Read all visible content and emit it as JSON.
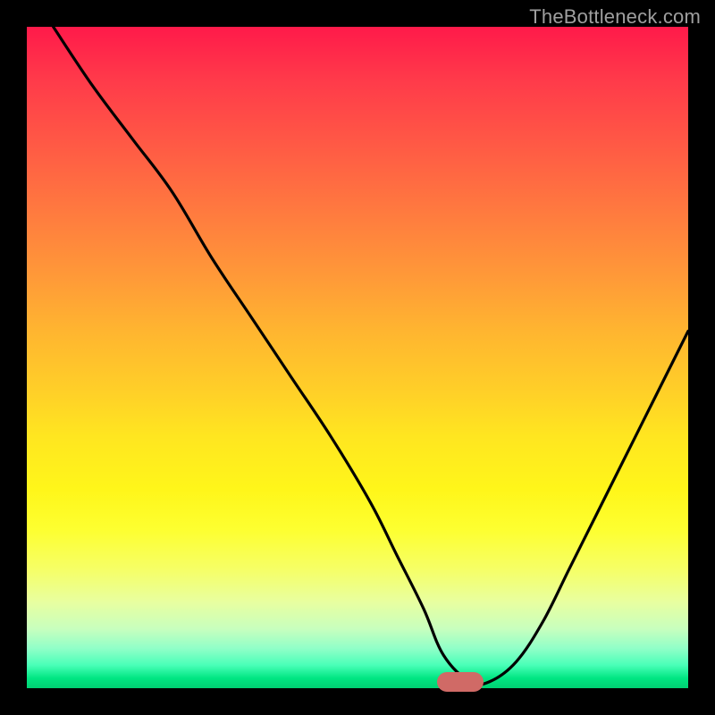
{
  "watermark": {
    "text": "TheBottleneck.com"
  },
  "marker": {
    "x_pct": 65.5,
    "y_pct": 99.0
  },
  "chart_data": {
    "type": "line",
    "title": "",
    "xlabel": "",
    "ylabel": "",
    "xlim": [
      0,
      100
    ],
    "ylim": [
      0,
      100
    ],
    "grid": false,
    "legend": false,
    "series": [
      {
        "name": "bottleneck-curve",
        "x": [
          4,
          10,
          16,
          22,
          28,
          34,
          40,
          46,
          52,
          56,
          60,
          63,
          67,
          70,
          74,
          78,
          82,
          86,
          90,
          94,
          98,
          100
        ],
        "values": [
          100,
          91,
          83,
          75,
          65,
          56,
          47,
          38,
          28,
          20,
          12,
          5,
          1,
          1,
          4,
          10,
          18,
          26,
          34,
          42,
          50,
          54
        ]
      }
    ],
    "marker": {
      "x": 65.5,
      "y": 1
    },
    "background_gradient": {
      "top_color": "#ff1a4a",
      "bottom_color": "#00d072",
      "stops": [
        "red",
        "orange",
        "yellow",
        "light-yellow",
        "light-green",
        "green"
      ]
    }
  }
}
